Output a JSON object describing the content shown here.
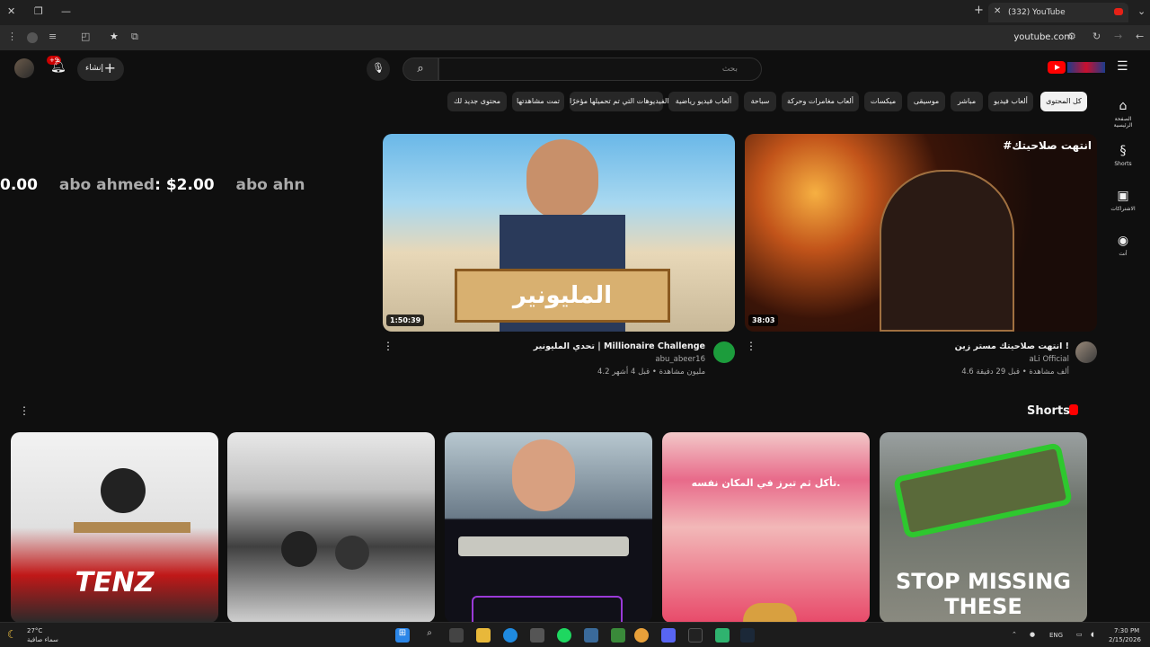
{
  "browser": {
    "tab_title": "(332) YouTube",
    "url": "youtube.com",
    "new_tab_icon": "+"
  },
  "masthead": {
    "search_placeholder": "بحث",
    "create_label": "إنشاء",
    "notification_count": "+9"
  },
  "chips": [
    "كل المحتوى",
    "ألعاب فيديو",
    "مباشر",
    "موسيقى",
    "ميكسات",
    "ألعاب مغامرات وحركة",
    "سباحة",
    "ألعاب فيديو رياضية",
    "الفيديوهات التي تم تحميلها مؤخرًا",
    "تمت مشاهدتها",
    "محتوى جديد لك"
  ],
  "guide": [
    {
      "label": "الصفحة الرئيسية",
      "icon": "home-icon"
    },
    {
      "label": "Shorts",
      "icon": "shorts-icon"
    },
    {
      "label": "الاشتراكات",
      "icon": "subscriptions-icon"
    },
    {
      "label": "أنت",
      "icon": "you-icon"
    }
  ],
  "ticker": {
    "prefix_amount": "0.00",
    "name1": "abo ahmed",
    "amount1": ": $2.00",
    "name2": "abo ahn"
  },
  "videos": [
    {
      "title": "انتهت صلاحيتك مستر زين !",
      "channel": "aLi Official",
      "meta": "4.6 ألف مشاهدة • قبل 29 دقيقة",
      "duration": "38:03",
      "thumb_caption": "#انتهت صلاحيتك"
    },
    {
      "title": "تحدي المليونير | Millionaire Challenge",
      "channel": "abu_abeer16",
      "meta": "4.2 مليون مشاهدة • قبل 4 أشهر",
      "duration": "1:50:39",
      "thumb_caption": "المليونير"
    }
  ],
  "shorts_section": {
    "title": "Shorts",
    "items": [
      {
        "caption": "TENZ"
      },
      {
        "caption": ""
      },
      {
        "caption": ""
      },
      {
        "caption": "تأكل ثم تبرز في المكان نفسه."
      },
      {
        "caption": "STOP MISSING THESE"
      }
    ]
  },
  "taskbar": {
    "weather_temp": "27°C",
    "weather_desc": "سماء صافية",
    "lang": "ENG",
    "time": "7:30 PM",
    "date": "2/15/2026"
  },
  "colors": {
    "background": "#0f0f0f",
    "accent_red": "#ff0000",
    "chip_bg": "#272727",
    "chip_active_bg": "#f1f1f1"
  }
}
